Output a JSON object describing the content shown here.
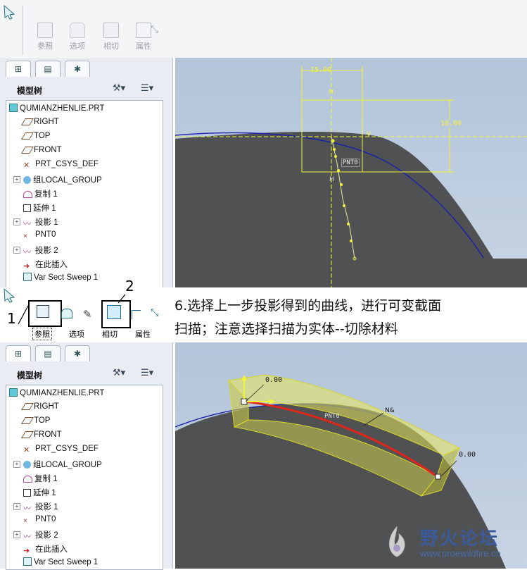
{
  "toolbar": {
    "items": [
      {
        "label": "参照",
        "icon": "reference-icon"
      },
      {
        "label": "选项",
        "icon": "options-icon"
      },
      {
        "label": "相切",
        "icon": "tangent-icon"
      },
      {
        "label": "属性",
        "icon": "properties-icon"
      }
    ]
  },
  "panel": {
    "tree_title": "模型树",
    "items": [
      {
        "label": "QUMIANZHENLIE.PRT",
        "icon": "part-icon"
      },
      {
        "label": "RIGHT",
        "icon": "datum-plane-icon"
      },
      {
        "label": "TOP",
        "icon": "datum-plane-icon"
      },
      {
        "label": "FRONT",
        "icon": "datum-plane-icon"
      },
      {
        "label": "PRT_CSYS_DEF",
        "icon": "csys-icon"
      },
      {
        "label": "组LOCAL_GROUP",
        "icon": "group-icon"
      },
      {
        "label": "复制 1",
        "icon": "copy-icon"
      },
      {
        "label": "延伸 1",
        "icon": "extend-icon"
      },
      {
        "label": "投影 1",
        "icon": "projection-icon"
      },
      {
        "label": "PNT0",
        "icon": "datum-point-icon"
      },
      {
        "label": "投影 2",
        "icon": "projection-icon"
      },
      {
        "label": "在此插入",
        "icon": "insert-here-arrow-icon"
      },
      {
        "label": "Var Sect Sweep 1",
        "icon": "sweep-icon"
      }
    ]
  },
  "view_top": {
    "dim_width": "15.00",
    "dim_height": "18.00",
    "point_label": "PNT0",
    "axis_v": "V",
    "axis_n": "N",
    "axis_h": "H"
  },
  "view_bottom": {
    "dim_start": "0.00",
    "dim_end": "0.00",
    "point_label": "PNT0",
    "tag": "N&"
  },
  "caption": {
    "marker_1": "1",
    "marker_2": "2",
    "line1": "6.选择上一步投影得到的曲线，进行可变截面",
    "line2": "扫描；注意选择扫描为实体--切除材料"
  },
  "watermark": {
    "text": "野火论坛",
    "url": "www.proewildfire.cn"
  },
  "colors": {
    "viewport_bg": "#b3c4d9",
    "solid": "#4f5153",
    "curve": "#1a22a8",
    "sketch_yellow": "#f2f23a",
    "sweep_red": "#e0241a"
  }
}
